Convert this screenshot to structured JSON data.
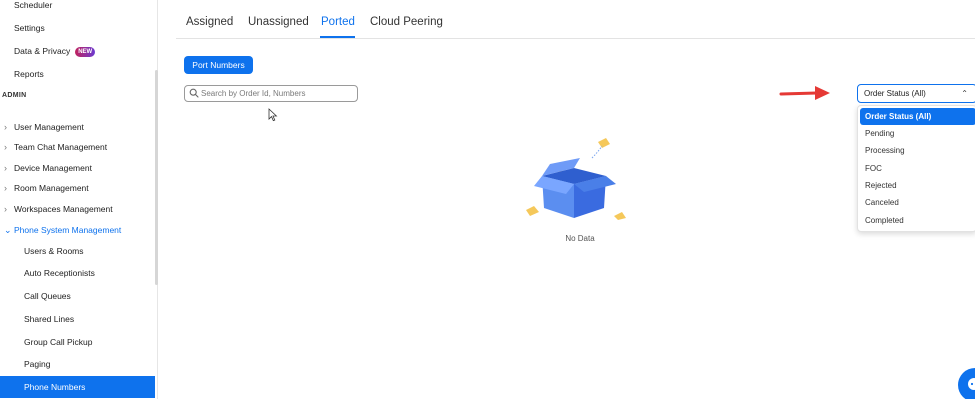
{
  "sidebar": {
    "top_items": [
      {
        "label": "Scheduler"
      },
      {
        "label": "Settings"
      },
      {
        "label": "Data & Privacy",
        "badge": "NEW"
      },
      {
        "label": "Reports"
      }
    ],
    "section_header": "ADMIN",
    "admin_items": [
      {
        "label": "User Management"
      },
      {
        "label": "Team Chat Management"
      },
      {
        "label": "Device Management"
      },
      {
        "label": "Room Management"
      },
      {
        "label": "Workspaces Management"
      },
      {
        "label": "Phone System Management"
      }
    ],
    "phone_sub_items": [
      {
        "label": "Users & Rooms"
      },
      {
        "label": "Auto Receptionists"
      },
      {
        "label": "Call Queues"
      },
      {
        "label": "Shared Lines"
      },
      {
        "label": "Group Call Pickup"
      },
      {
        "label": "Paging"
      },
      {
        "label": "Phone Numbers"
      }
    ]
  },
  "tabs": [
    {
      "label": "Assigned"
    },
    {
      "label": "Unassigned"
    },
    {
      "label": "Ported"
    },
    {
      "label": "Cloud Peering"
    }
  ],
  "toolbar": {
    "port_numbers_label": "Port Numbers",
    "search_placeholder": "Search by Order Id, Numbers"
  },
  "status_filter": {
    "selected": "Order Status (All)",
    "options": [
      "Order Status (All)",
      "Pending",
      "Processing",
      "FOC",
      "Rejected",
      "Canceled",
      "Completed"
    ]
  },
  "empty_state": {
    "text": "No Data"
  },
  "colors": {
    "accent": "#0e72ed",
    "arrow": "#e53935",
    "box": "#4a7fe0"
  }
}
